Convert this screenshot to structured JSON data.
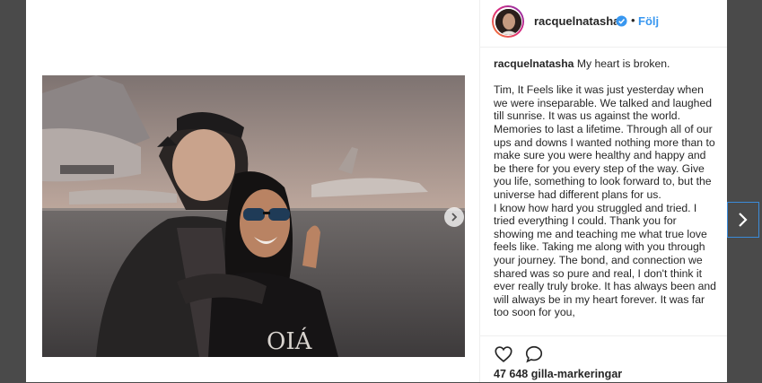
{
  "header": {
    "username": "racquelnatasha",
    "separator": "•",
    "follow_label": "Följ"
  },
  "caption": {
    "username": "racquelnatasha",
    "first_line": "My heart is broken.",
    "paragraph1": "Tim, It Feels like it was just yesterday when we were inseparable. We talked and laughed till sunrise. It was us against the world. Memories to last a lifetime. Through all of our ups and downs I wanted nothing more than to make sure you were healthy and happy and be there for you every step of the way. Give you life, something to look forward to, but the universe had different plans for us.",
    "paragraph2": "I know how hard you struggled and tried. I tried everything I could. Thank you for showing me and teaching me what true love feels like. Taking me along with you through your journey. The bond, and connection we shared was so pure and real, I don't think it ever really truly broke. It has always been and will always be in my heart forever. It was far too soon for you,"
  },
  "photo": {
    "shirt_text": "OIÁ"
  },
  "actions": {
    "likes": "47 648 gilla-markeringar"
  },
  "icons": {
    "verified": "verified-badge-icon",
    "like": "heart-icon",
    "comment": "comment-bubble-icon",
    "carousel_next": "chevron-right-icon",
    "next_post": "chevron-right-icon"
  },
  "colors": {
    "backdrop": "#4a4a4a",
    "link_blue": "#3897f0",
    "text": "#262626"
  }
}
